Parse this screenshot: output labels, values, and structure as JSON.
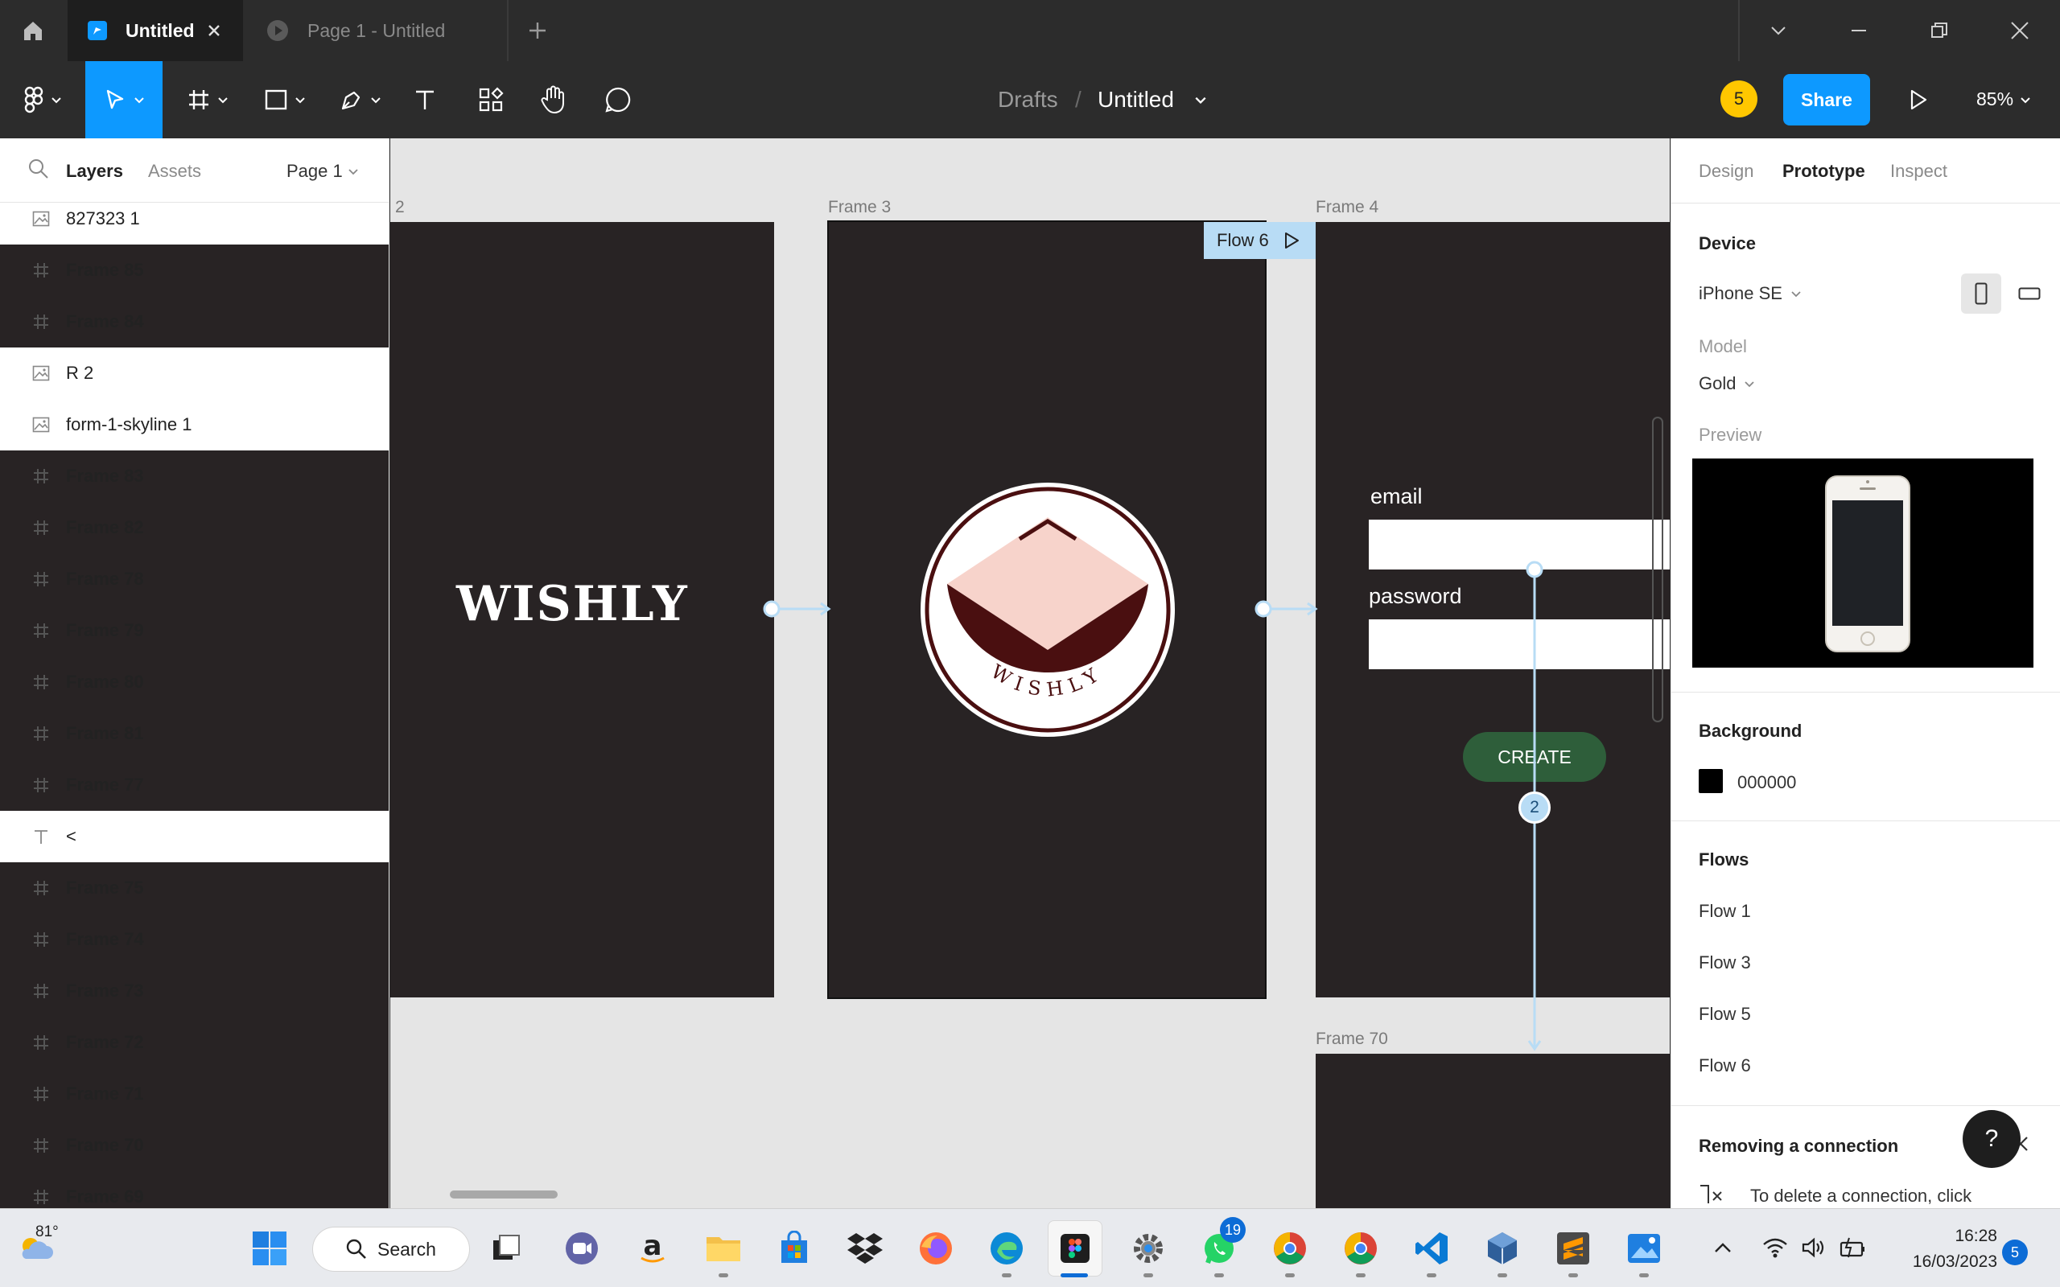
{
  "titlebar": {
    "active_tab": "Untitled",
    "inactive_tab": "Page 1 - Untitled"
  },
  "toolbar": {
    "breadcrumb_parent": "Drafts",
    "breadcrumb_separator": "/",
    "file_name": "Untitled",
    "collaborator_count": "5",
    "share_label": "Share",
    "zoom": "85%"
  },
  "left_panel": {
    "tabs": [
      "Layers",
      "Assets"
    ],
    "page_selector": "Page 1",
    "layers": [
      {
        "name": "827323 1",
        "type": "image"
      },
      {
        "name": "Frame 85",
        "type": "frame"
      },
      {
        "name": "Frame 84",
        "type": "frame"
      },
      {
        "name": "R 2",
        "type": "image"
      },
      {
        "name": "form-1-skyline 1",
        "type": "image"
      },
      {
        "name": "Frame 83",
        "type": "frame"
      },
      {
        "name": "Frame 82",
        "type": "frame"
      },
      {
        "name": "Frame 78",
        "type": "frame"
      },
      {
        "name": "Frame 79",
        "type": "frame"
      },
      {
        "name": "Frame 80",
        "type": "frame"
      },
      {
        "name": "Frame 81",
        "type": "frame"
      },
      {
        "name": "Frame 77",
        "type": "frame"
      },
      {
        "name": "<",
        "type": "text"
      },
      {
        "name": "Frame 75",
        "type": "frame"
      },
      {
        "name": "Frame 74",
        "type": "frame"
      },
      {
        "name": "Frame 73",
        "type": "frame"
      },
      {
        "name": "Frame 72",
        "type": "frame"
      },
      {
        "name": "Frame 71",
        "type": "frame"
      },
      {
        "name": "Frame 70",
        "type": "frame"
      },
      {
        "name": "Frame 69",
        "type": "frame"
      }
    ]
  },
  "canvas": {
    "frame_2_label": "2",
    "frame_3_label": "Frame 3",
    "frame_4_label": "Frame 4",
    "frame_70_label": "Frame 70",
    "flow_badge": "Flow 6",
    "wordmark": "WISHLY",
    "logo_text": "WISHLY",
    "email_label": "email",
    "password_label": "password",
    "create_button": "CREATE",
    "connection_count": "2"
  },
  "right_panel": {
    "tabs": [
      "Design",
      "Prototype",
      "Inspect"
    ],
    "active_tab": "Prototype",
    "device_title": "Device",
    "device_value": "iPhone SE",
    "model_label": "Model",
    "model_value": "Gold",
    "preview_label": "Preview",
    "background_title": "Background",
    "background_value": "000000",
    "flows_title": "Flows",
    "flows": [
      "Flow 1",
      "Flow 3",
      "Flow 5",
      "Flow 6"
    ],
    "tip_title": "Removing a connection",
    "tip_text": "To delete a connection, click",
    "help_label": "?"
  },
  "taskbar": {
    "weather_temp": "81°",
    "search_label": "Search",
    "whatsapp_badge": "19",
    "time": "16:28",
    "date": "16/03/2023",
    "notification_count": "5"
  },
  "colors": {
    "accent": "#0d99ff",
    "frame_bg": "#282324",
    "create_button": "#2e5e3a",
    "logo_dark": "#4a0f10",
    "logo_pink": "#f7d3cb",
    "prototype_line": "#b8dcf5"
  }
}
